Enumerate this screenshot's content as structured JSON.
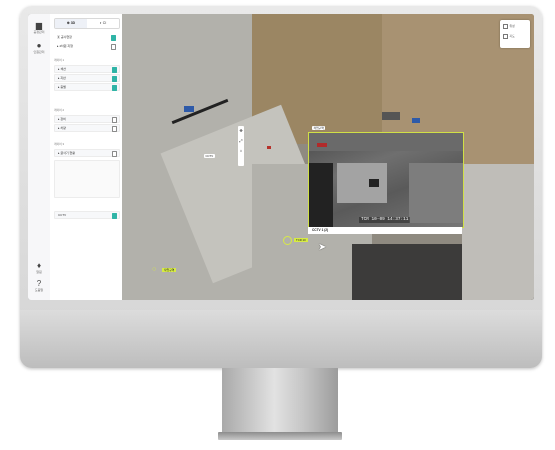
{
  "sidebar_rail": {
    "items": [
      {
        "icon": "folder-icon",
        "label": "공정관리"
      },
      {
        "icon": "user-icon",
        "label": "인원관리"
      },
      {
        "icon": "bell-icon",
        "label": "알림"
      },
      {
        "icon": "help-icon",
        "label": "도움말"
      }
    ]
  },
  "panel": {
    "tabs": [
      {
        "label": "⊕ 3D",
        "active": true
      },
      {
        "label": "◐ CI",
        "active": false
      }
    ],
    "rows": [
      {
        "text": "▣ 공사현장",
        "tag": "",
        "checked": true,
        "card": false
      },
      {
        "text": "▸ 4차원 지형",
        "tag": "",
        "checked": false,
        "card": false
      },
      {
        "text": "▸ 섹션",
        "tag": "",
        "checked": true,
        "card": true
      },
      {
        "text": "▸ 지반",
        "tag": "",
        "checked": true,
        "card": true
      },
      {
        "text": "▸ 층별",
        "tag": "",
        "checked": true,
        "card": true
      },
      {
        "text": "▸ 장비",
        "tag": "",
        "checked": false,
        "card": true
      },
      {
        "text": "▸ 차량",
        "tag": "",
        "checked": false,
        "card": true
      },
      {
        "text": "▸ 굴삭기 현황",
        "tag": "",
        "checked": false,
        "card": true
      },
      {
        "text": "CCTV",
        "tag": "",
        "checked": true,
        "card": true
      }
    ],
    "section_labels": [
      "레이어 1",
      "레이어 2",
      "레이어 3"
    ]
  },
  "map": {
    "labels": [
      "작업구역",
      "CCTV",
      "TCR 10"
    ],
    "tools": [
      "✥",
      "⤢",
      "⌂"
    ],
    "popup_items": [
      "위성",
      "지도"
    ]
  },
  "cctv": {
    "timestamp": "TCR 10-09 14:37:11",
    "camera_label": "CCTV 1 (2)"
  },
  "colors": {
    "accent": "#d4e64a",
    "panel_accent": "#2fb4a6"
  }
}
